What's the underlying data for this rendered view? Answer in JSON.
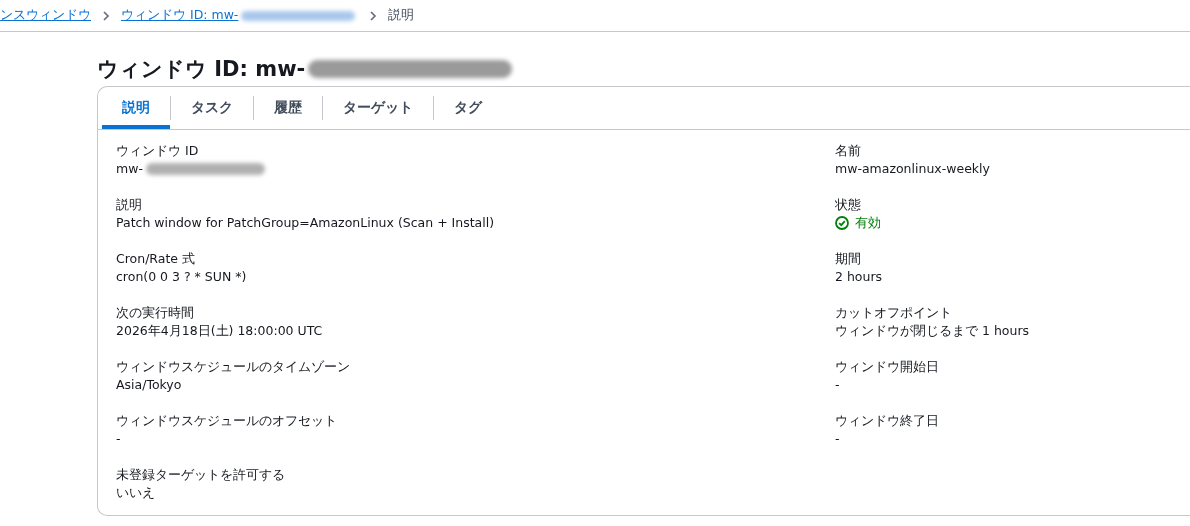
{
  "breadcrumb": [
    {
      "label": "ンスウィンドウ",
      "kind": "link",
      "redacted": false
    },
    {
      "label": "ウィンドウ ID: mw-",
      "kind": "link",
      "redacted": true
    },
    {
      "label": "説明",
      "kind": "current",
      "redacted": false
    }
  ],
  "title": {
    "text": "ウィンドウ ID: mw-",
    "redacted": true
  },
  "tabs": [
    {
      "label": "説明",
      "selected": true
    },
    {
      "label": "タスク",
      "selected": false
    },
    {
      "label": "履歴",
      "selected": false
    },
    {
      "label": "ターゲット",
      "selected": false
    },
    {
      "label": "タグ",
      "selected": false
    }
  ],
  "left_fields": [
    {
      "label": "ウィンドウ ID",
      "value": "mw-",
      "kind": "text",
      "redacted": true
    },
    {
      "label": "説明",
      "value": "Patch window for PatchGroup=AmazonLinux (Scan + Install)",
      "kind": "text",
      "redacted": false
    },
    {
      "label": "Cron/Rate 式",
      "value": "cron(0 0 3 ? * SUN *)",
      "kind": "text",
      "redacted": false
    },
    {
      "label": "次の実行時間",
      "value": "2026年4月18日(土) 18:00:00 UTC",
      "kind": "text",
      "redacted": false
    },
    {
      "label": "ウィンドウスケジュールのタイムゾーン",
      "value": "Asia/Tokyo",
      "kind": "text",
      "redacted": false
    },
    {
      "label": "ウィンドウスケジュールのオフセット",
      "value": "-",
      "kind": "text",
      "redacted": false
    },
    {
      "label": "未登録ターゲットを許可する",
      "value": "いいえ",
      "kind": "text",
      "redacted": false
    }
  ],
  "right_fields": [
    {
      "label": "名前",
      "value": "mw-amazonlinux-weekly",
      "kind": "text",
      "redacted": false
    },
    {
      "label": "状態",
      "value": "有効",
      "kind": "status",
      "redacted": false
    },
    {
      "label": "期間",
      "value": "2 hours",
      "kind": "text",
      "redacted": false
    },
    {
      "label": "カットオフポイント",
      "value": "ウィンドウが閉じるまで 1 hours",
      "kind": "text",
      "redacted": false
    },
    {
      "label": "ウィンドウ開始日",
      "value": "-",
      "kind": "text",
      "redacted": false
    },
    {
      "label": "ウィンドウ終了日",
      "value": "-",
      "kind": "text",
      "redacted": false
    }
  ]
}
